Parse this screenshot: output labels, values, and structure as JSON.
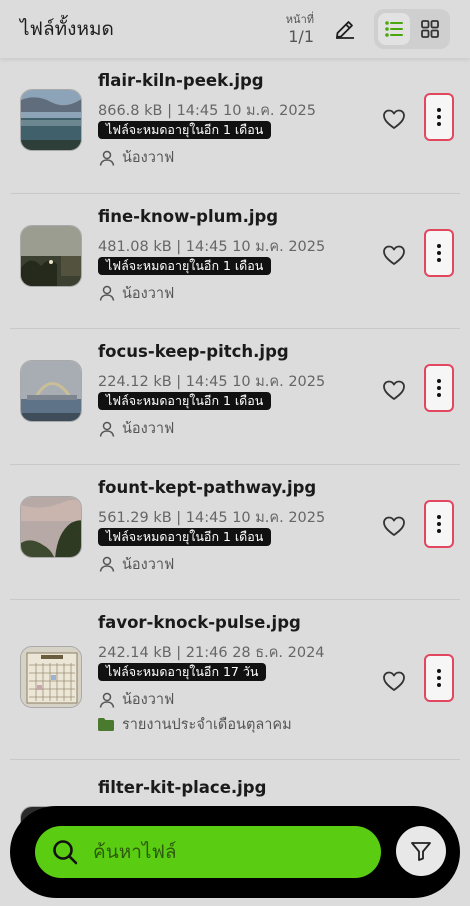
{
  "header": {
    "title": "ไฟล์ทั้งหมด",
    "page_label": "หน้าที่",
    "page_value": "1/1",
    "accent": "#5acd12"
  },
  "files": [
    {
      "name": "flair-kiln-peek.jpg",
      "meta": "866.8 kB | 14:45 10 ม.ค. 2025",
      "expiry": "ไฟล์จะหมดอายุในอีก 1 เดือน",
      "owner": "น้องวาฟ"
    },
    {
      "name": "fine-know-plum.jpg",
      "meta": "481.08 kB | 14:45 10 ม.ค. 2025",
      "expiry": "ไฟล์จะหมดอายุในอีก 1 เดือน",
      "owner": "น้องวาฟ"
    },
    {
      "name": "focus-keep-pitch.jpg",
      "meta": "224.12 kB | 14:45 10 ม.ค. 2025",
      "expiry": "ไฟล์จะหมดอายุในอีก 1 เดือน",
      "owner": "น้องวาฟ"
    },
    {
      "name": "fount-kept-pathway.jpg",
      "meta": "561.29 kB | 14:45 10 ม.ค. 2025",
      "expiry": "ไฟล์จะหมดอายุในอีก 1 เดือน",
      "owner": "น้องวาฟ"
    },
    {
      "name": "favor-knock-pulse.jpg",
      "meta": "242.14 kB | 21:46 28 ธ.ค. 2024",
      "expiry": "ไฟล์จะหมดอายุในอีก 17 วัน",
      "owner": "น้องวาฟ",
      "folder": "รายงานประจำเดือนตุลาคม"
    },
    {
      "name": "filter-kit-place.jpg"
    }
  ],
  "search": {
    "placeholder": "ค้นหาไฟล์"
  },
  "icons": {
    "edit": "pencil-icon",
    "list": "list-view-icon",
    "grid": "grid-view-icon",
    "heart": "heart-icon",
    "more": "more-vertical-icon",
    "user": "user-icon",
    "folder": "folder-icon",
    "search": "search-icon",
    "filter": "filter-icon"
  },
  "colors": {
    "folder": "#4a7a2e",
    "more_border": "#e2475f",
    "badge_bg": "#111111"
  }
}
